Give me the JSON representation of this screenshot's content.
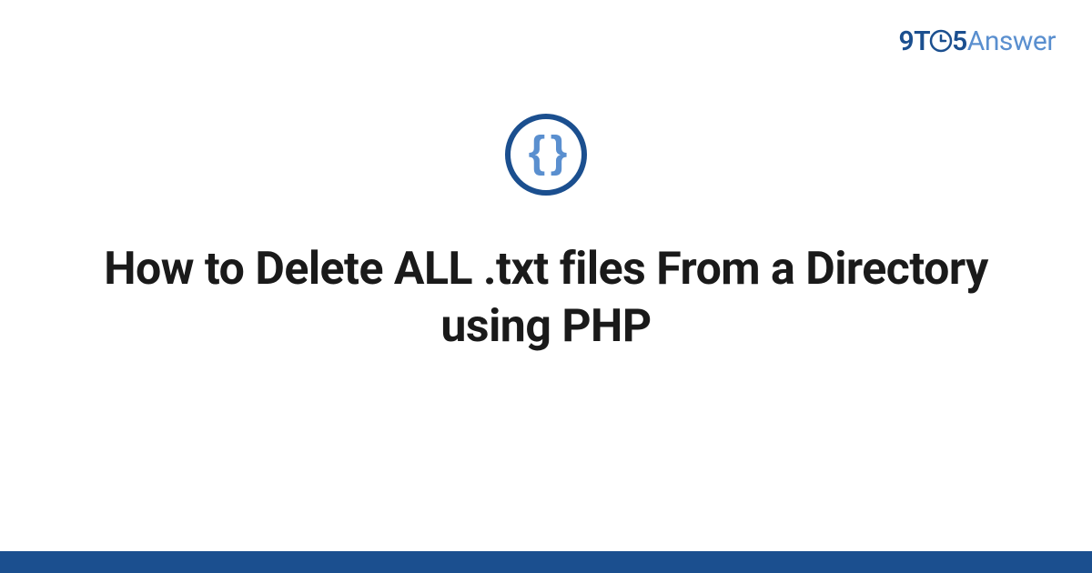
{
  "logo": {
    "part1": "9T",
    "part2": "5",
    "part3": "Answer"
  },
  "icon": {
    "name": "code-braces-icon",
    "glyph": "{ }"
  },
  "title": "How to Delete ALL .txt files From a Directory using PHP",
  "colors": {
    "primary": "#1b4f8f",
    "secondary": "#5a8fcf",
    "text": "#1a1a1a"
  }
}
